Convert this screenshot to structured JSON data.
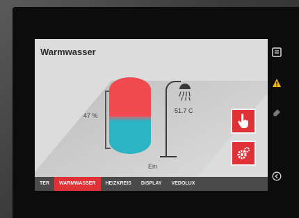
{
  "screen": {
    "title": "Warmwasser",
    "tank": {
      "level_label": "47 %",
      "hot_fraction": 0.51
    },
    "shower": {
      "temperature": "51.7 C"
    },
    "status": "Ein"
  },
  "tabs": [
    {
      "label": "TER",
      "active": false
    },
    {
      "label": "WARMWASSER",
      "active": true
    },
    {
      "label": "HEIZKREIS",
      "active": false
    },
    {
      "label": "DISPLAY",
      "active": false
    },
    {
      "label": "VEDOLUX",
      "active": false
    }
  ],
  "side_icons": [
    "menu-icon",
    "warning-icon",
    "eraser-icon",
    "back-icon"
  ],
  "colors": {
    "accent": "#e03236",
    "hot": "#f04a4f",
    "cold": "#2bb4c4",
    "warning": "#f5b800"
  }
}
